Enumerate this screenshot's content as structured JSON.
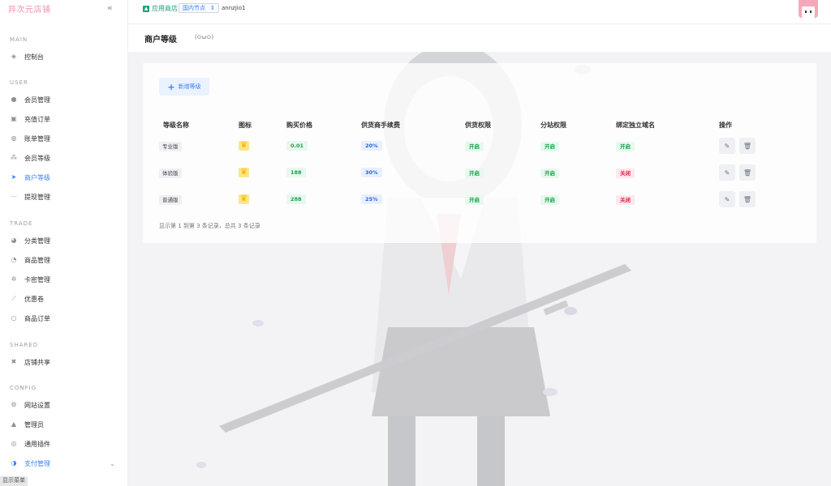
{
  "brand": "异次元店铺",
  "sidebar": {
    "sections": [
      {
        "label": "MAIN",
        "items": [
          {
            "label": "控制台",
            "icon": "dashboard-icon"
          }
        ]
      },
      {
        "label": "USER",
        "items": [
          {
            "label": "会员管理",
            "icon": "user-icon"
          },
          {
            "label": "充值订单",
            "icon": "recharge-icon"
          },
          {
            "label": "账单管理",
            "icon": "bill-icon"
          },
          {
            "label": "会员等级",
            "icon": "level-icon"
          },
          {
            "label": "商户等级",
            "icon": "merchant-level-icon",
            "active": true
          },
          {
            "label": "提现管理",
            "icon": "withdraw-icon"
          }
        ]
      },
      {
        "label": "TRADE",
        "items": [
          {
            "label": "分类管理",
            "icon": "category-icon"
          },
          {
            "label": "商品管理",
            "icon": "product-icon"
          },
          {
            "label": "卡密管理",
            "icon": "card-key-icon"
          },
          {
            "label": "优惠卷",
            "icon": "coupon-icon"
          },
          {
            "label": "商品订单",
            "icon": "order-icon"
          }
        ]
      },
      {
        "label": "SHARED",
        "items": [
          {
            "label": "店铺共享",
            "icon": "share-icon"
          }
        ]
      },
      {
        "label": "CONFIG",
        "items": [
          {
            "label": "网站设置",
            "icon": "settings-icon"
          },
          {
            "label": "管理员",
            "icon": "admin-icon"
          },
          {
            "label": "通用插件",
            "icon": "plugin-icon"
          },
          {
            "label": "支付管理",
            "icon": "payment-icon",
            "active": true,
            "expandable": true
          }
        ]
      }
    ],
    "show_menu": "显示菜单"
  },
  "topbar": {
    "store_link": "应用商店",
    "node_select": "国内节点",
    "username": "annzjio1"
  },
  "page": {
    "title": "商户等级",
    "face": "(⊙ω⊙)"
  },
  "table": {
    "add_button": "新增等级",
    "headers": [
      "等级名称",
      "图标",
      "购买价格",
      "供货商手续费",
      "供货权限",
      "分站权限",
      "绑定独立域名",
      "操作"
    ],
    "rows": [
      {
        "name": "专业版",
        "price": "0.01",
        "fee": "20%",
        "supply": "开启",
        "substation": "开启",
        "domain": "开启",
        "domain_state": "on"
      },
      {
        "name": "体验版",
        "price": "188",
        "fee": "30%",
        "supply": "开启",
        "substation": "开启",
        "domain": "关闭",
        "domain_state": "off"
      },
      {
        "name": "普通版",
        "price": "288",
        "fee": "25%",
        "supply": "开启",
        "substation": "开启",
        "domain": "关闭",
        "domain_state": "off"
      }
    ],
    "footer": "显示第 1 到第 3 条记录，总共 3 条记录"
  },
  "colors": {
    "accent": "#3b82f6",
    "brand": "#f48fb1",
    "on": "#16a34a",
    "off": "#e11d48"
  }
}
